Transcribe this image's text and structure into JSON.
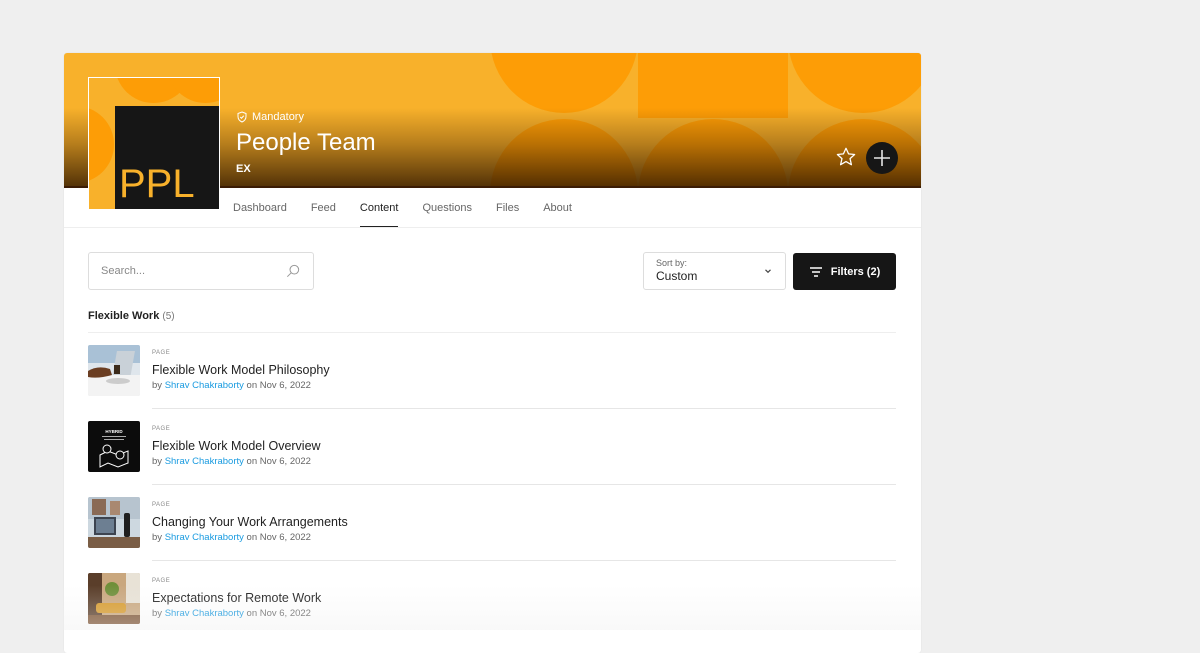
{
  "colors": {
    "banner_base": "#f8b12b",
    "banner_shape": "#fd9d06",
    "dark": "#161616",
    "link": "#1a9be0"
  },
  "group": {
    "logo_text": "PPL",
    "badge_icon": "shield-check-icon",
    "badge": "Mandatory",
    "title": "People Team",
    "subtitle": "EX",
    "favorite_icon": "star-icon",
    "add_icon": "plus-icon"
  },
  "tabs": [
    {
      "label": "Dashboard",
      "active": false
    },
    {
      "label": "Feed",
      "active": false
    },
    {
      "label": "Content",
      "active": true
    },
    {
      "label": "Questions",
      "active": false
    },
    {
      "label": "Files",
      "active": false
    },
    {
      "label": "About",
      "active": false
    }
  ],
  "toolbar": {
    "search_placeholder": "Search...",
    "search_icon": "search-icon",
    "sort_label": "Sort by:",
    "sort_value": "Custom",
    "filters_label": "Filters (2)",
    "filters_icon": "filter-lines-icon"
  },
  "section": {
    "title": "Flexible Work",
    "count": "(5)"
  },
  "items": [
    {
      "type": "PAGE",
      "title": "Flexible Work Model Philosophy",
      "by": "by ",
      "author": "Shrav Chakraborty",
      "date": " on Nov 6, 2022",
      "thumb": "laptop-coffee-photo"
    },
    {
      "type": "PAGE",
      "title": "Flexible Work Model Overview",
      "by": "by ",
      "author": "Shrav Chakraborty",
      "date": " on Nov 6, 2022",
      "thumb": "hybrid-map-graphic",
      "thumb_text": "HYBRID"
    },
    {
      "type": "PAGE",
      "title": "Changing Your Work Arrangements",
      "by": "by ",
      "author": "Shrav Chakraborty",
      "date": " on Nov 6, 2022",
      "thumb": "laptop-window-photo"
    },
    {
      "type": "PAGE",
      "title": "Expectations for Remote Work",
      "by": "by ",
      "author": "Shrav Chakraborty",
      "date": " on Nov 6, 2022",
      "thumb": "living-room-photo"
    }
  ]
}
